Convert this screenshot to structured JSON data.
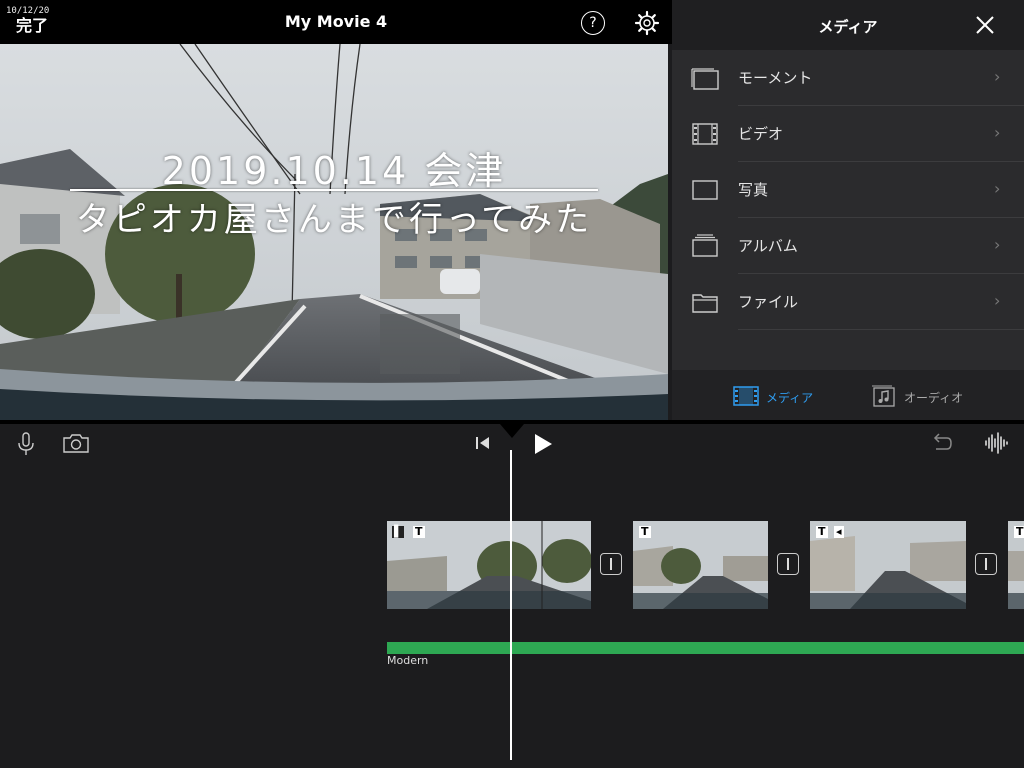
{
  "header": {
    "done_label": "完了",
    "title": "My Movie 4",
    "help_icon": "question-circle-icon",
    "settings_icon": "gear-icon"
  },
  "preview": {
    "date_stamp": "10/12/20 ",
    "caption_line1": "2019.10.14 会津",
    "caption_line2": "タピオカ屋さんまで行ってみた"
  },
  "media_panel": {
    "title": "メディア",
    "close_icon": "close-icon",
    "items": [
      {
        "label": "モーメント",
        "icon": "moments-icon"
      },
      {
        "label": "ビデオ",
        "icon": "film-icon"
      },
      {
        "label": "写真",
        "icon": "photo-icon"
      },
      {
        "label": "アルバム",
        "icon": "album-icon"
      },
      {
        "label": "ファイル",
        "icon": "folder-icon"
      }
    ],
    "tabs": [
      {
        "label": "メディア",
        "icon": "film-icon",
        "active": true
      },
      {
        "label": "オーディオ",
        "icon": "music-note-icon",
        "active": false
      }
    ],
    "accent_color": "#2f9df0"
  },
  "timeline": {
    "music_track_label": "Modern",
    "music_color": "#2ea853",
    "clip_badges": [
      "T",
      "T",
      "T",
      "T"
    ]
  }
}
